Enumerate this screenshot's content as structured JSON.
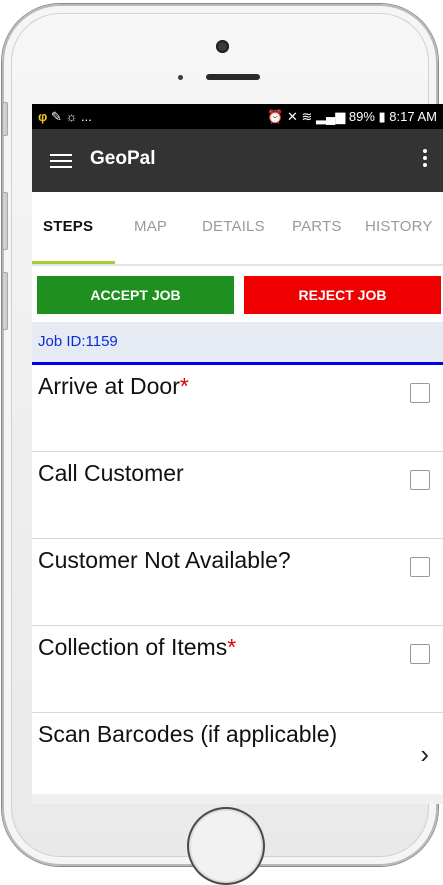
{
  "status_bar": {
    "left_text": "...",
    "right_text": "89%",
    "time": "8:17 AM"
  },
  "app_bar": {
    "title": "GeoPal"
  },
  "tabs": [
    {
      "label": "STEPS",
      "active": true
    },
    {
      "label": "MAP",
      "active": false
    },
    {
      "label": "DETAILS",
      "active": false
    },
    {
      "label": "PARTS",
      "active": false
    },
    {
      "label": "HISTORY",
      "active": false
    }
  ],
  "actions": {
    "accept_label": "ACCEPT JOB",
    "reject_label": "REJECT JOB"
  },
  "job": {
    "id_label": "Job ID:1159"
  },
  "steps": [
    {
      "label": "Arrive at Door",
      "required": "*",
      "control": "checkbox"
    },
    {
      "label": "Call Customer",
      "required": "",
      "control": "checkbox"
    },
    {
      "label": "Customer Not Available?",
      "required": "",
      "control": "checkbox"
    },
    {
      "label": "Collection of Items",
      "required": "*",
      "control": "checkbox"
    },
    {
      "label": "Scan Barcodes (if applicable)",
      "required": "",
      "control": "chevron"
    }
  ],
  "colors": {
    "accent_tab": "#9fcf33",
    "accept": "#1f8f1f",
    "reject": "#f00000",
    "job_id": "#0a2ed8",
    "required": "#e00000"
  }
}
